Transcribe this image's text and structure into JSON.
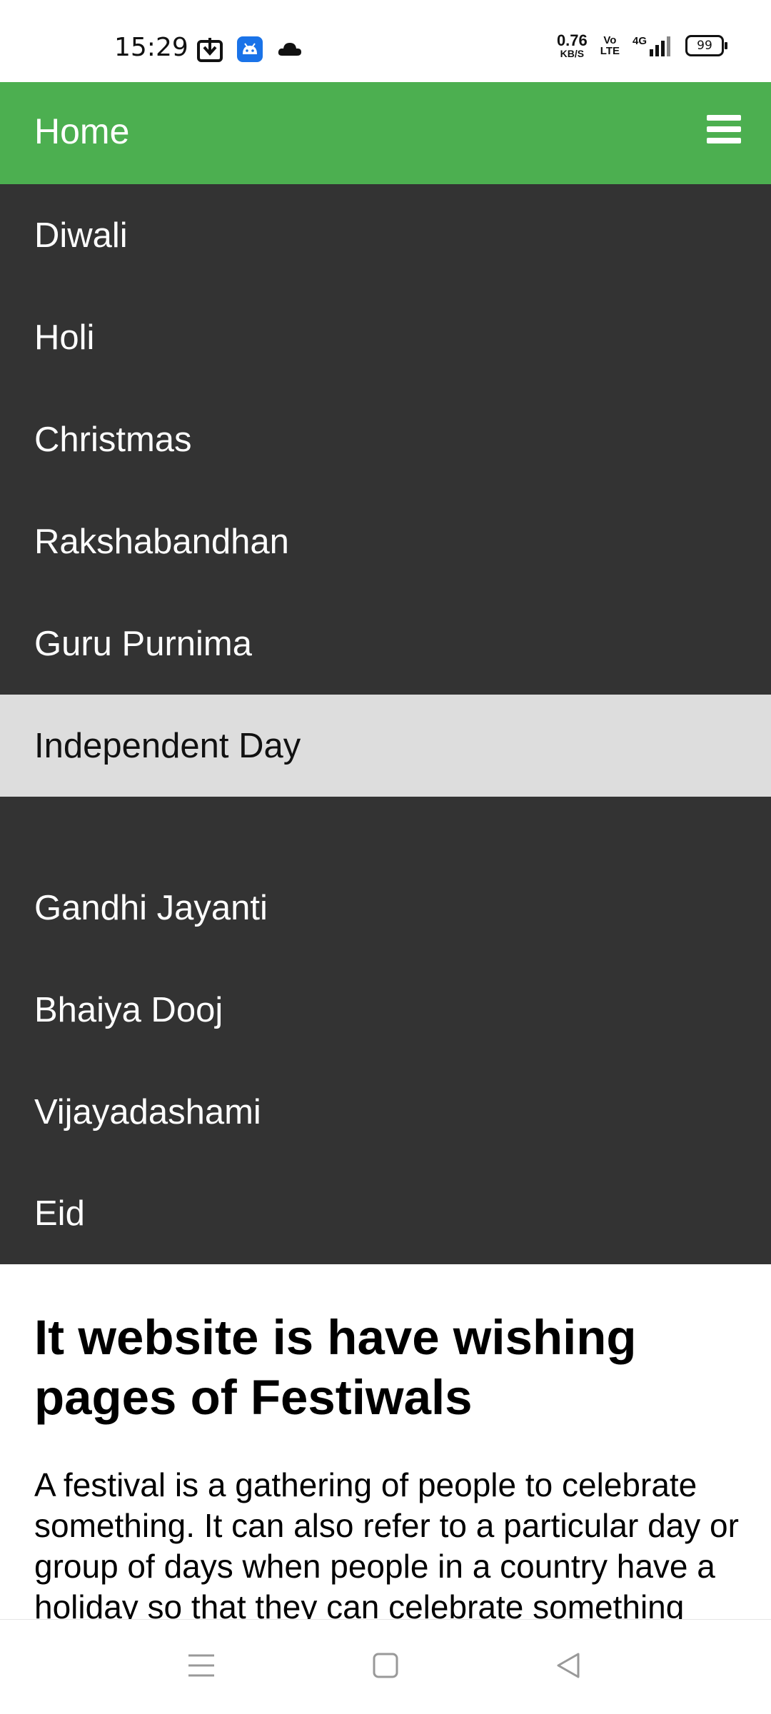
{
  "status_bar": {
    "time": "15:29",
    "net_speed_value": "0.76",
    "net_speed_unit": "KB/S",
    "volte_top": "Vo",
    "volte_bottom": "LTE",
    "network": "4G",
    "battery": "99",
    "icons": [
      "download-icon",
      "android-icon",
      "cloud-icon",
      "signal-icon"
    ]
  },
  "header": {
    "title": "Home",
    "menu_icon": "hamburger-menu-icon",
    "color": "#4caf50"
  },
  "nav": {
    "background": "#333333",
    "active_background": "#dddddd",
    "items": [
      {
        "label": "Diwali"
      },
      {
        "label": "Holi"
      },
      {
        "label": "Christmas"
      },
      {
        "label": "Rakshabandhan"
      },
      {
        "label": "Guru Purnima"
      },
      {
        "label": "Independent Day",
        "active": true
      },
      {
        "label": ""
      },
      {
        "label": "Gandhi Jayanti"
      },
      {
        "label": "Bhaiya Dooj"
      },
      {
        "label": "Vijayadashami"
      },
      {
        "label": "Eid"
      }
    ]
  },
  "main": {
    "heading": "It website is have wishing pages of Festiwals",
    "paragraph": "A festival is a gathering of people to celebrate something. It can also refer to a particular day or group of days when people in a country have a holiday so that they can celebrate something"
  },
  "system_nav": {
    "icons": [
      "recents-icon",
      "home-icon",
      "back-icon"
    ]
  }
}
